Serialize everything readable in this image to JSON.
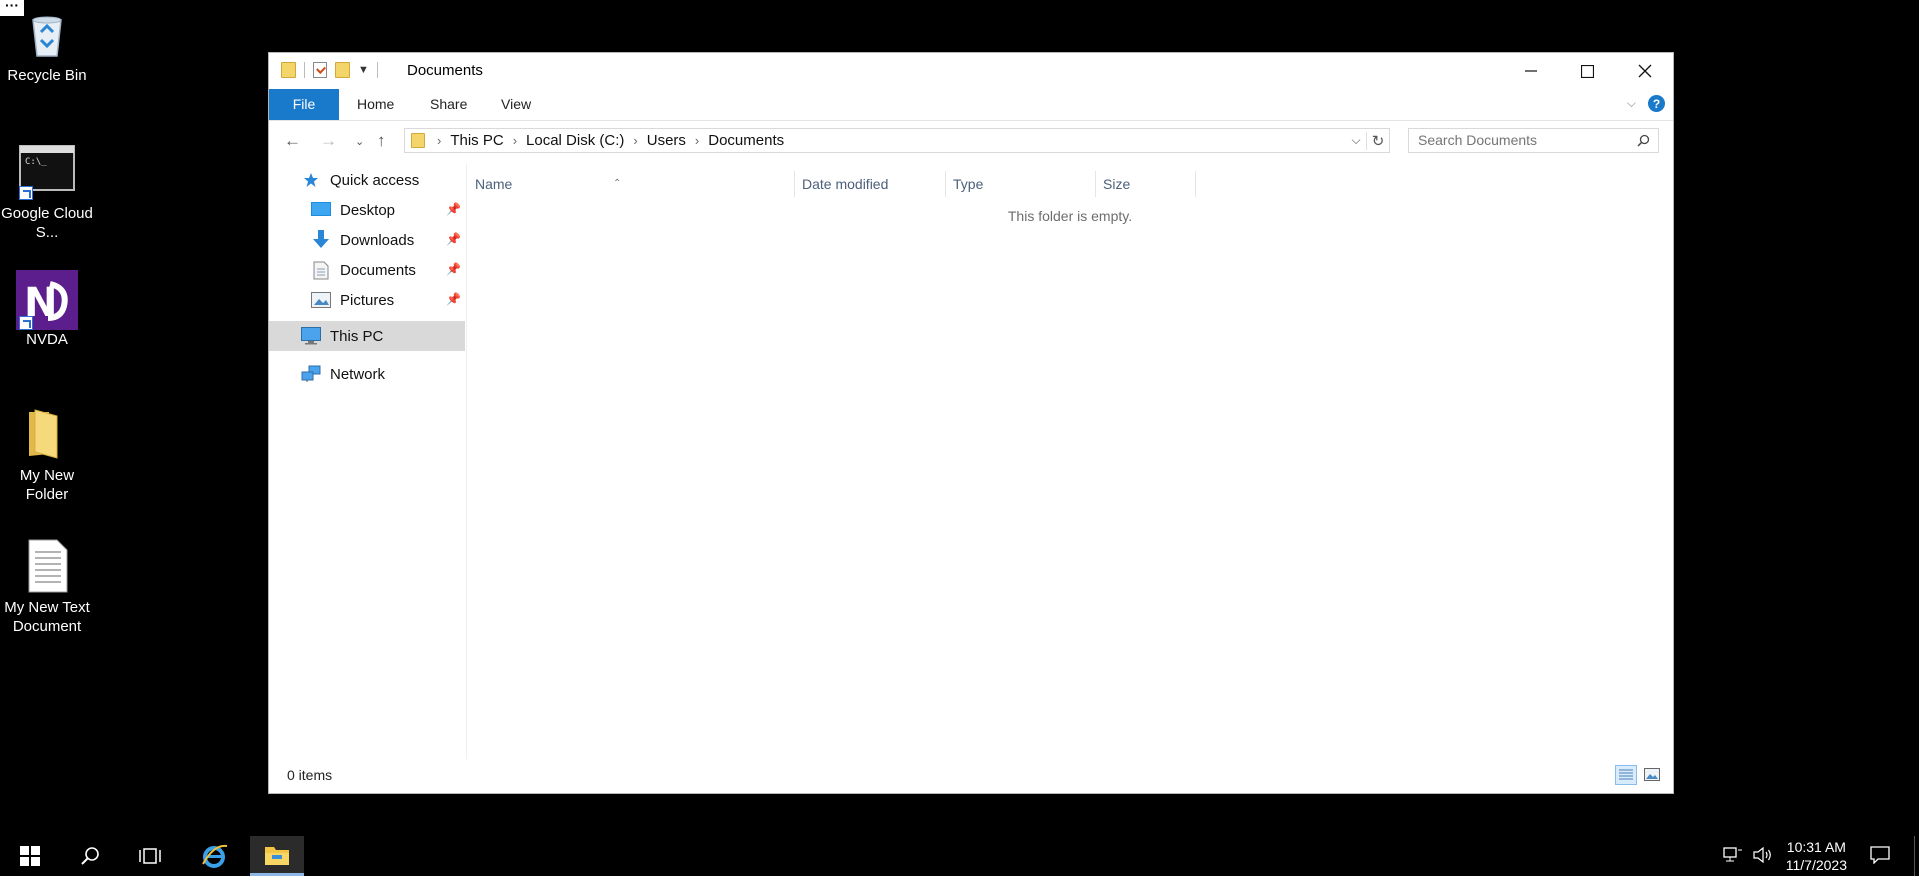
{
  "desktop": {
    "icons": [
      {
        "label": "Recycle Bin"
      },
      {
        "label": "Google Cloud S..."
      },
      {
        "label": "NVDA"
      },
      {
        "label": "My New Folder"
      },
      {
        "label": "My New Text Document"
      }
    ]
  },
  "window": {
    "title": "Documents",
    "ribbon_tabs": [
      "File",
      "Home",
      "Share",
      "View"
    ],
    "help_label": "?",
    "breadcrumb": [
      "This PC",
      "Local Disk (C:)",
      "Users",
      "Documents"
    ],
    "search_placeholder": "Search Documents",
    "nav": {
      "quick_access": "Quick access",
      "desktop": "Desktop",
      "downloads": "Downloads",
      "documents": "Documents",
      "pictures": "Pictures",
      "this_pc": "This PC",
      "network": "Network"
    },
    "columns": [
      "Name",
      "Date modified",
      "Type",
      "Size"
    ],
    "empty_message": "This folder is empty.",
    "status_count": "0 items"
  },
  "taskbar": {
    "time": "10:31 AM",
    "date": "11/7/2023"
  },
  "colors": {
    "accent": "#1979ca",
    "selected_nav": "#d9d9d9",
    "folder": "#f4d56a"
  }
}
